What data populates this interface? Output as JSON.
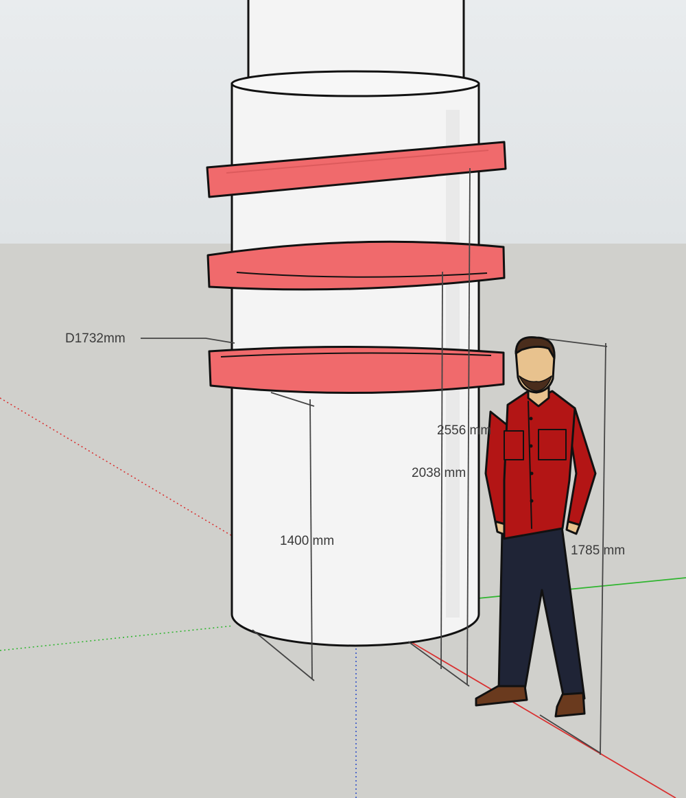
{
  "viewport": {
    "sky_color": "#dde2e4",
    "ground_color": "#d0d0cc",
    "column_color": "#f4f4f4",
    "ring_color": "#f06a6c",
    "axis_red": "#d93030",
    "axis_green": "#2fb52f",
    "axis_blue": "#3050c8"
  },
  "dimensions": {
    "diameter_label": "D1732mm",
    "first_ring_height": "1400 mm",
    "second_ring_height": "2038 mm",
    "third_ring_height": "2556 mm",
    "person_height": "1785 mm"
  },
  "person": {
    "shirt_color": "#b31515",
    "pants_color": "#1f2436",
    "skin_color": "#e8c28e",
    "hair_color": "#4a2d1c",
    "shoe_color": "#6a3a1e"
  }
}
